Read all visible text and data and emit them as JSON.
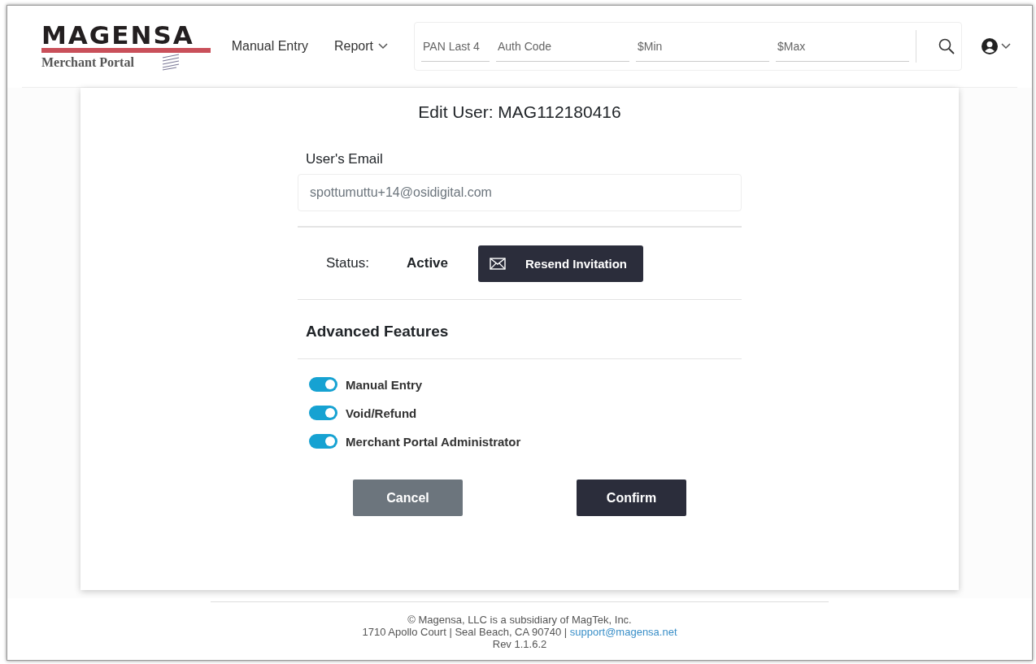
{
  "header": {
    "logo": {
      "wordmark": "MAGENSA",
      "subtitle": "Merchant Portal"
    },
    "nav": [
      {
        "label": "Manual Entry",
        "kind": "link"
      },
      {
        "label": "Report",
        "kind": "dropdown"
      }
    ],
    "search_fields": [
      {
        "placeholder": "PAN Last 4"
      },
      {
        "placeholder": "Auth Code"
      },
      {
        "placeholder": "$Min"
      },
      {
        "placeholder": "$Max"
      }
    ]
  },
  "form": {
    "title": "Edit User: MAG112180416",
    "email": {
      "label": "User's Email",
      "value": "spottumuttu+14@osidigital.com"
    },
    "status": {
      "label": "Status:",
      "value": "Active",
      "button": "Resend Invitation"
    },
    "section_title": "Advanced Features",
    "features": [
      {
        "label": "Manual Entry",
        "on": true
      },
      {
        "label": "Void/Refund",
        "on": true
      },
      {
        "label": "Merchant Portal Administrator",
        "on": true
      }
    ],
    "buttons": [
      {
        "label": "Cancel",
        "kind": "secondary"
      },
      {
        "label": "Confirm",
        "kind": "primary"
      }
    ]
  },
  "footer": {
    "line1": "© Magensa, LLC is a subsidiary of MagTek, Inc.",
    "address": "1710 Apollo Court | Seal Beach, CA 90740 | ",
    "link": "support@magensa.net",
    "rev": "Rev 1.1.6.2"
  }
}
